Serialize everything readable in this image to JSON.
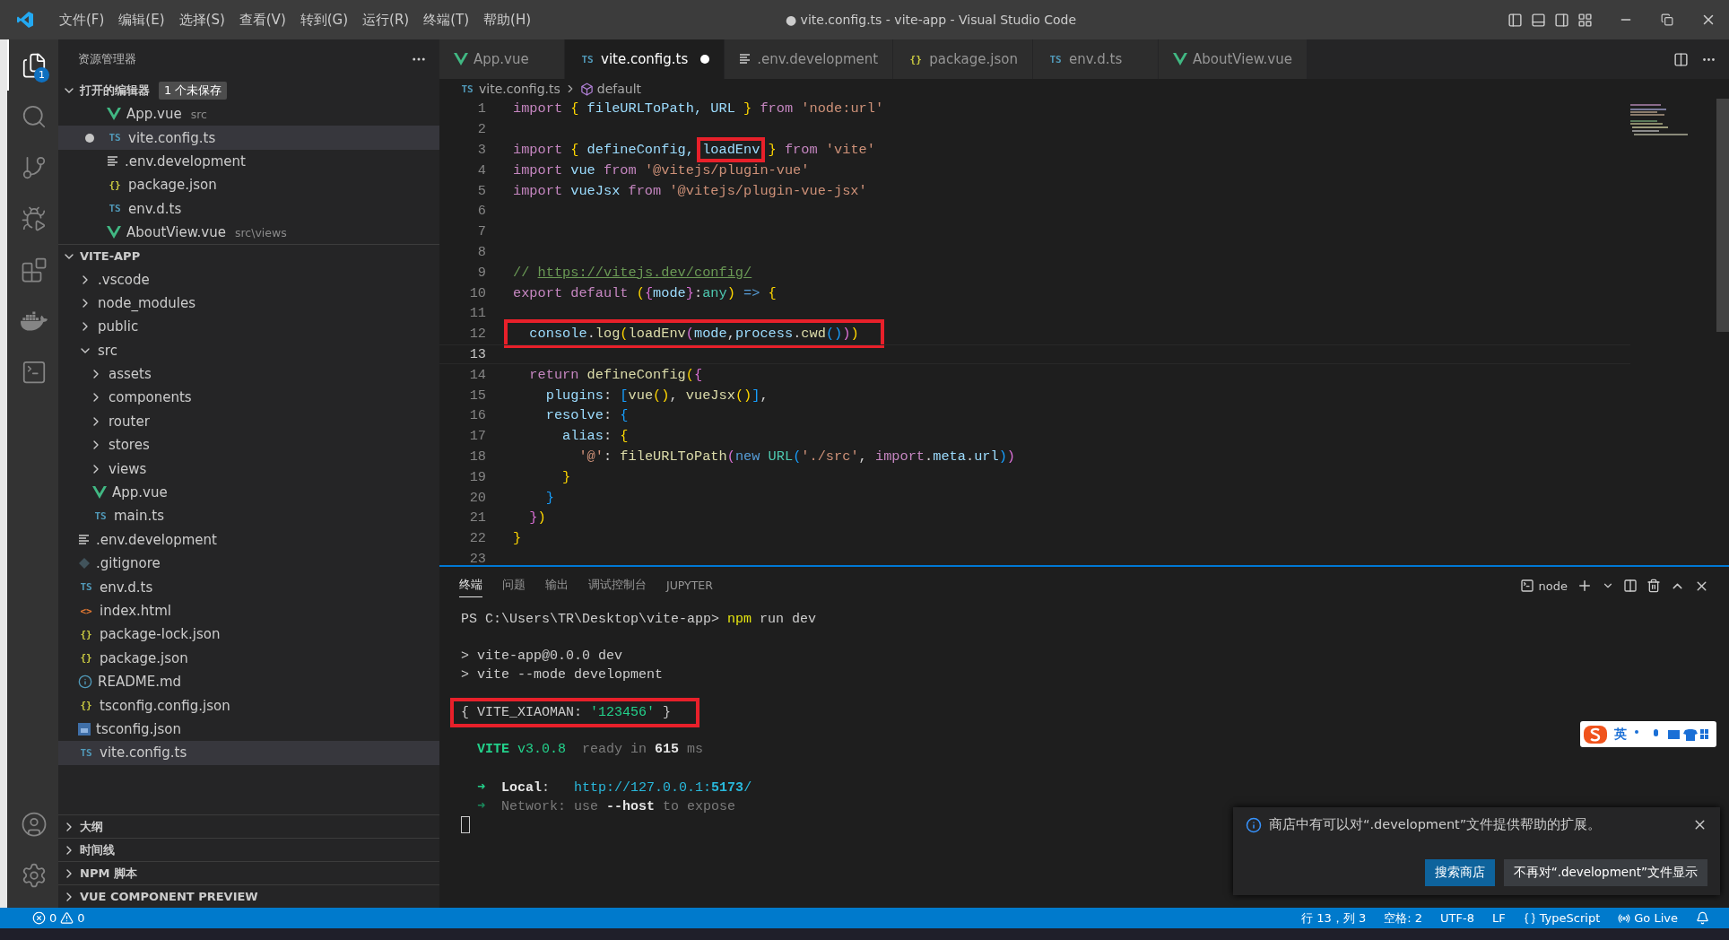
{
  "title_bar": {
    "menu": [
      "文件(F)",
      "编辑(E)",
      "选择(S)",
      "查看(V)",
      "转到(G)",
      "运行(R)",
      "终端(T)",
      "帮助(H)"
    ],
    "title": "● vite.config.ts - vite-app - Visual Studio Code"
  },
  "activity_bar": {
    "items": [
      {
        "kind": "explorer",
        "selected": true,
        "badge": "1"
      },
      {
        "kind": "search",
        "selected": false
      },
      {
        "kind": "git",
        "selected": false
      },
      {
        "kind": "debug",
        "selected": false
      },
      {
        "kind": "extensions",
        "selected": false
      },
      {
        "kind": "whale",
        "selected": false
      },
      {
        "kind": "terminal",
        "selected": false
      }
    ],
    "bottom": [
      {
        "kind": "account"
      },
      {
        "kind": "settings"
      }
    ]
  },
  "sidebar": {
    "title": "资源管理器",
    "open_editors": {
      "label": "打开的编辑器",
      "expanded": true,
      "badge": "1 个未保存",
      "items": [
        {
          "name": "App.vue",
          "path": "src",
          "kind": "vue",
          "dirty": false,
          "selected": false
        },
        {
          "name": "vite.config.ts",
          "kind": "ts",
          "icon_text": "TS",
          "dirty": true,
          "selected": true
        },
        {
          "name": ".env.development",
          "kind": "env",
          "dirty": false,
          "selected": false
        },
        {
          "name": "package.json",
          "kind": "json",
          "icon_text": "{}",
          "dirty": false,
          "selected": false
        },
        {
          "name": "env.d.ts",
          "kind": "ts",
          "icon_text": "TS",
          "dirty": false,
          "selected": false
        },
        {
          "name": "AboutView.vue",
          "path": "src\\views",
          "kind": "vue",
          "dirty": false,
          "selected": false
        }
      ]
    },
    "project": {
      "label": "VITE-APP",
      "expanded": true,
      "items": [
        {
          "kind": "folder",
          "name": ".vscode",
          "expanded": false,
          "selected": false
        },
        {
          "kind": "folder",
          "name": "node_modules",
          "expanded": false,
          "selected": false
        },
        {
          "kind": "folder",
          "name": "public",
          "expanded": false,
          "selected": false
        },
        {
          "kind": "folder",
          "name": "src",
          "expanded": true,
          "selected": false,
          "children": [
            {
              "kind": "folder",
              "name": "assets",
              "expanded": false,
              "selected": false
            },
            {
              "kind": "folder",
              "name": "components",
              "expanded": false,
              "selected": false
            },
            {
              "kind": "folder",
              "name": "router",
              "expanded": false,
              "selected": false
            },
            {
              "kind": "folder",
              "name": "stores",
              "expanded": false,
              "selected": false
            },
            {
              "kind": "folder",
              "name": "views",
              "expanded": false,
              "selected": false
            },
            {
              "kind": "vue",
              "name": "App.vue",
              "selected": false
            },
            {
              "kind": "ts",
              "name": "main.ts",
              "icon_text": "TS",
              "selected": false
            }
          ]
        },
        {
          "kind": "env",
          "name": ".env.development",
          "selected": false
        },
        {
          "kind": "git",
          "name": ".gitignore",
          "selected": false
        },
        {
          "kind": "ts",
          "name": "env.d.ts",
          "icon_text": "TS",
          "selected": false
        },
        {
          "kind": "html",
          "name": "index.html",
          "icon_text": "<>",
          "selected": false
        },
        {
          "kind": "json",
          "name": "package-lock.json",
          "icon_text": "{}",
          "selected": false
        },
        {
          "kind": "json",
          "name": "package.json",
          "icon_text": "{}",
          "selected": false
        },
        {
          "kind": "info",
          "name": "README.md",
          "selected": false
        },
        {
          "kind": "json",
          "name": "tsconfig.config.json",
          "icon_text": "{}",
          "selected": false
        },
        {
          "kind": "tsconfig",
          "name": "tsconfig.json",
          "selected": false
        },
        {
          "kind": "ts",
          "name": "vite.config.ts",
          "icon_text": "TS",
          "selected": true
        }
      ]
    },
    "sections": [
      {
        "label": "大纲",
        "expanded": false
      },
      {
        "label": "时间线",
        "expanded": false
      },
      {
        "label": "NPM 脚本",
        "expanded": false
      },
      {
        "label": "VUE COMPONENT PREVIEW",
        "expanded": false
      }
    ]
  },
  "tabs": [
    {
      "label": "App.vue",
      "kind": "vue",
      "selected": false,
      "dirty": false
    },
    {
      "label": "vite.config.ts",
      "kind": "ts",
      "icon_text": "TS",
      "selected": true,
      "dirty": true
    },
    {
      "label": ".env.development",
      "kind": "env",
      "selected": false,
      "dirty": false
    },
    {
      "label": "package.json",
      "kind": "json",
      "icon_text": "{}",
      "selected": false,
      "dirty": false
    },
    {
      "label": "env.d.ts",
      "kind": "ts",
      "icon_text": "TS",
      "selected": false,
      "dirty": false
    },
    {
      "label": "AboutView.vue",
      "kind": "vue",
      "selected": false,
      "dirty": false
    }
  ],
  "breadcrumb": {
    "file": "vite.config.ts",
    "icon_text": "TS",
    "symbol": "default"
  },
  "code": [
    {
      "number": "1",
      "current": false,
      "tokens": [
        {
          "text": "import",
          "kind": "kw"
        },
        {
          "text": " {",
          "kind": "b1"
        },
        {
          "text": " fileURLToPath, URL ",
          "kind": "var"
        },
        {
          "text": "}",
          "kind": "b1"
        },
        {
          "text": " from",
          "kind": "kw"
        },
        {
          "text": " 'node:url'",
          "kind": "str"
        }
      ]
    },
    {
      "number": "2",
      "current": false
    },
    {
      "number": "3",
      "current": false,
      "tokens": [
        {
          "text": "import",
          "kind": "kw"
        },
        {
          "text": " {",
          "kind": "b1"
        },
        {
          "text": " defineConfig, ",
          "kind": "var"
        },
        {
          "text": "loadEnv",
          "kind": "var",
          "boxed": true
        },
        {
          "text": " }",
          "kind": "b1"
        },
        {
          "text": " from",
          "kind": "kw"
        },
        {
          "text": " 'vite'",
          "kind": "str"
        }
      ]
    },
    {
      "number": "4",
      "current": false,
      "tokens": [
        {
          "text": "import",
          "kind": "kw"
        },
        {
          "text": " vue ",
          "kind": "var"
        },
        {
          "text": "from",
          "kind": "kw"
        },
        {
          "text": " '@vitejs/plugin-vue'",
          "kind": "str"
        }
      ]
    },
    {
      "number": "5",
      "current": false,
      "tokens": [
        {
          "text": "import",
          "kind": "kw"
        },
        {
          "text": " vueJsx ",
          "kind": "var"
        },
        {
          "text": "from",
          "kind": "kw"
        },
        {
          "text": " '@vitejs/plugin-vue-jsx'",
          "kind": "str"
        }
      ]
    },
    {
      "number": "6",
      "current": false
    },
    {
      "number": "7",
      "current": false
    },
    {
      "number": "8",
      "current": false
    },
    {
      "number": "9",
      "current": false,
      "tokens": [
        {
          "text": "// ",
          "kind": "comment"
        },
        {
          "text": "https://vitejs.dev/config/",
          "kind": "link"
        }
      ]
    },
    {
      "number": "10",
      "current": false,
      "tokens": [
        {
          "text": "export",
          "kind": "kw"
        },
        {
          "text": " default",
          "kind": "kw"
        },
        {
          "text": " (",
          "kind": "b1"
        },
        {
          "text": "{",
          "kind": "b2"
        },
        {
          "text": "mode",
          "kind": "var"
        },
        {
          "text": "}",
          "kind": "b2"
        },
        {
          "text": ":",
          "kind": "plain"
        },
        {
          "text": "any",
          "kind": "type"
        },
        {
          "text": ")",
          "kind": "b1"
        },
        {
          "text": " => ",
          "kind": "blue"
        },
        {
          "text": "{",
          "kind": "b1"
        }
      ]
    },
    {
      "number": "11",
      "current": false
    },
    {
      "number": "12",
      "current": false,
      "boxed": true,
      "tokens": [
        {
          "text": "  console",
          "kind": "var"
        },
        {
          "text": ".",
          "kind": "plain"
        },
        {
          "text": "log",
          "kind": "fn"
        },
        {
          "text": "(",
          "kind": "b1"
        },
        {
          "text": "loadEnv",
          "kind": "fn"
        },
        {
          "text": "(",
          "kind": "b2"
        },
        {
          "text": "mode",
          "kind": "var"
        },
        {
          "text": ",",
          "kind": "plain"
        },
        {
          "text": "process",
          "kind": "var"
        },
        {
          "text": ".",
          "kind": "plain"
        },
        {
          "text": "cwd",
          "kind": "fn"
        },
        {
          "text": "()",
          "kind": "b3"
        },
        {
          "text": ")",
          "kind": "b2"
        },
        {
          "text": ")",
          "kind": "b1"
        }
      ]
    },
    {
      "number": "13",
      "current": true
    },
    {
      "number": "14",
      "current": false,
      "tokens": [
        {
          "text": "  return",
          "kind": "kw"
        },
        {
          "text": " defineConfig",
          "kind": "fn"
        },
        {
          "text": "(",
          "kind": "b1"
        },
        {
          "text": "{",
          "kind": "b2"
        }
      ]
    },
    {
      "number": "15",
      "current": false,
      "tokens": [
        {
          "text": "    plugins",
          "kind": "var"
        },
        {
          "text": ": ",
          "kind": "plain"
        },
        {
          "text": "[",
          "kind": "b3"
        },
        {
          "text": "vue",
          "kind": "fn"
        },
        {
          "text": "()",
          "kind": "b1"
        },
        {
          "text": ", ",
          "kind": "plain"
        },
        {
          "text": "vueJsx",
          "kind": "fn"
        },
        {
          "text": "()",
          "kind": "b1"
        },
        {
          "text": "]",
          "kind": "b3"
        },
        {
          "text": ",",
          "kind": "plain"
        }
      ]
    },
    {
      "number": "16",
      "current": false,
      "tokens": [
        {
          "text": "    resolve",
          "kind": "var"
        },
        {
          "text": ": ",
          "kind": "plain"
        },
        {
          "text": "{",
          "kind": "b3"
        }
      ]
    },
    {
      "number": "17",
      "current": false,
      "tokens": [
        {
          "text": "      alias",
          "kind": "var"
        },
        {
          "text": ": ",
          "kind": "plain"
        },
        {
          "text": "{",
          "kind": "b1"
        }
      ]
    },
    {
      "number": "18",
      "current": false,
      "tokens": [
        {
          "text": "        '@'",
          "kind": "str"
        },
        {
          "text": ": ",
          "kind": "plain"
        },
        {
          "text": "fileURLToPath",
          "kind": "fn"
        },
        {
          "text": "(",
          "kind": "b2"
        },
        {
          "text": "new",
          "kind": "blue"
        },
        {
          "text": " URL",
          "kind": "type"
        },
        {
          "text": "(",
          "kind": "b3"
        },
        {
          "text": "'./src'",
          "kind": "str"
        },
        {
          "text": ", ",
          "kind": "plain"
        },
        {
          "text": "import",
          "kind": "kw"
        },
        {
          "text": ".",
          "kind": "plain"
        },
        {
          "text": "meta",
          "kind": "var"
        },
        {
          "text": ".",
          "kind": "plain"
        },
        {
          "text": "url",
          "kind": "var"
        },
        {
          "text": ")",
          "kind": "b3"
        },
        {
          "text": ")",
          "kind": "b2"
        }
      ]
    },
    {
      "number": "19",
      "current": false,
      "tokens": [
        {
          "text": "      }",
          "kind": "b1"
        }
      ]
    },
    {
      "number": "20",
      "current": false,
      "tokens": [
        {
          "text": "    }",
          "kind": "b3"
        }
      ]
    },
    {
      "number": "21",
      "current": false,
      "tokens": [
        {
          "text": "  }",
          "kind": "b2"
        },
        {
          "text": ")",
          "kind": "b1"
        }
      ]
    },
    {
      "number": "22",
      "current": false,
      "tokens": [
        {
          "text": "}",
          "kind": "b1"
        }
      ]
    },
    {
      "number": "23",
      "current": false
    }
  ],
  "panel": {
    "tabs": [
      {
        "label": "终端",
        "selected": true
      },
      {
        "label": "问题",
        "selected": false
      },
      {
        "label": "输出",
        "selected": false
      },
      {
        "label": "调试控制台",
        "selected": false
      },
      {
        "label": "JUPYTER",
        "selected": false
      }
    ],
    "shell": "node",
    "lines": [
      {
        "kind": "text",
        "tokens": [
          {
            "text": "PS C:\\Users\\TR\\Desktop\\vite-app> ",
            "kind": "plain"
          },
          {
            "text": "npm",
            "kind": "yellow"
          },
          {
            "text": " run dev",
            "kind": "plain"
          }
        ]
      },
      {
        "kind": "blank"
      },
      {
        "kind": "text",
        "tokens": [
          {
            "text": "> vite-app@0.0.0 dev",
            "kind": "plain"
          }
        ]
      },
      {
        "kind": "text",
        "tokens": [
          {
            "text": "> vite --mode development",
            "kind": "plain"
          }
        ]
      },
      {
        "kind": "blank"
      },
      {
        "kind": "text",
        "boxed": true,
        "tokens": [
          {
            "text": "{ VITE_XIAOMAN: ",
            "kind": "plain"
          },
          {
            "text": "'123456'",
            "kind": "green"
          },
          {
            "text": " }",
            "kind": "plain"
          }
        ]
      },
      {
        "kind": "blank"
      },
      {
        "kind": "text",
        "tokens": [
          {
            "text": "  VITE",
            "kind": "greenbold"
          },
          {
            "text": " v3.0.8",
            "kind": "green"
          },
          {
            "text": "  ready in ",
            "kind": "dim"
          },
          {
            "text": "615",
            "kind": "bold"
          },
          {
            "text": " ms",
            "kind": "dim"
          }
        ]
      },
      {
        "kind": "blank"
      },
      {
        "kind": "text",
        "tokens": [
          {
            "text": "  ➜  ",
            "kind": "green"
          },
          {
            "text": "Local",
            "kind": "bold"
          },
          {
            "text": ":   ",
            "kind": "plain"
          },
          {
            "text": "http://127.0.0.1:",
            "kind": "cyan"
          },
          {
            "text": "5173",
            "kind": "cyanbold"
          },
          {
            "text": "/",
            "kind": "cyan"
          }
        ]
      },
      {
        "kind": "text",
        "tokens": [
          {
            "text": "  ➜  ",
            "kind": "dimgreen"
          },
          {
            "text": "Network",
            "kind": "dim"
          },
          {
            "text": ": use ",
            "kind": "dim"
          },
          {
            "text": "--host",
            "kind": "bold"
          },
          {
            "text": " to expose",
            "kind": "dim"
          }
        ]
      },
      {
        "kind": "cursor"
      }
    ]
  },
  "ime_toolbar": {
    "label": "英"
  },
  "notification": {
    "message": "商店中有可以对“.development”文件提供帮助的扩展。",
    "buttons": [
      {
        "label": "搜索商店",
        "primary": true
      },
      {
        "label": "不再对“.development”文件显示",
        "primary": false
      }
    ]
  },
  "status_bar": {
    "errors": "0",
    "warnings": "0",
    "right": [
      {
        "kind": "text",
        "label": "行 13，列 3"
      },
      {
        "kind": "text",
        "label": "空格: 2"
      },
      {
        "kind": "text",
        "label": "UTF-8"
      },
      {
        "kind": "text",
        "label": "LF"
      },
      {
        "kind": "language",
        "label": "TypeScript"
      },
      {
        "kind": "live",
        "label": "Go Live"
      }
    ]
  }
}
